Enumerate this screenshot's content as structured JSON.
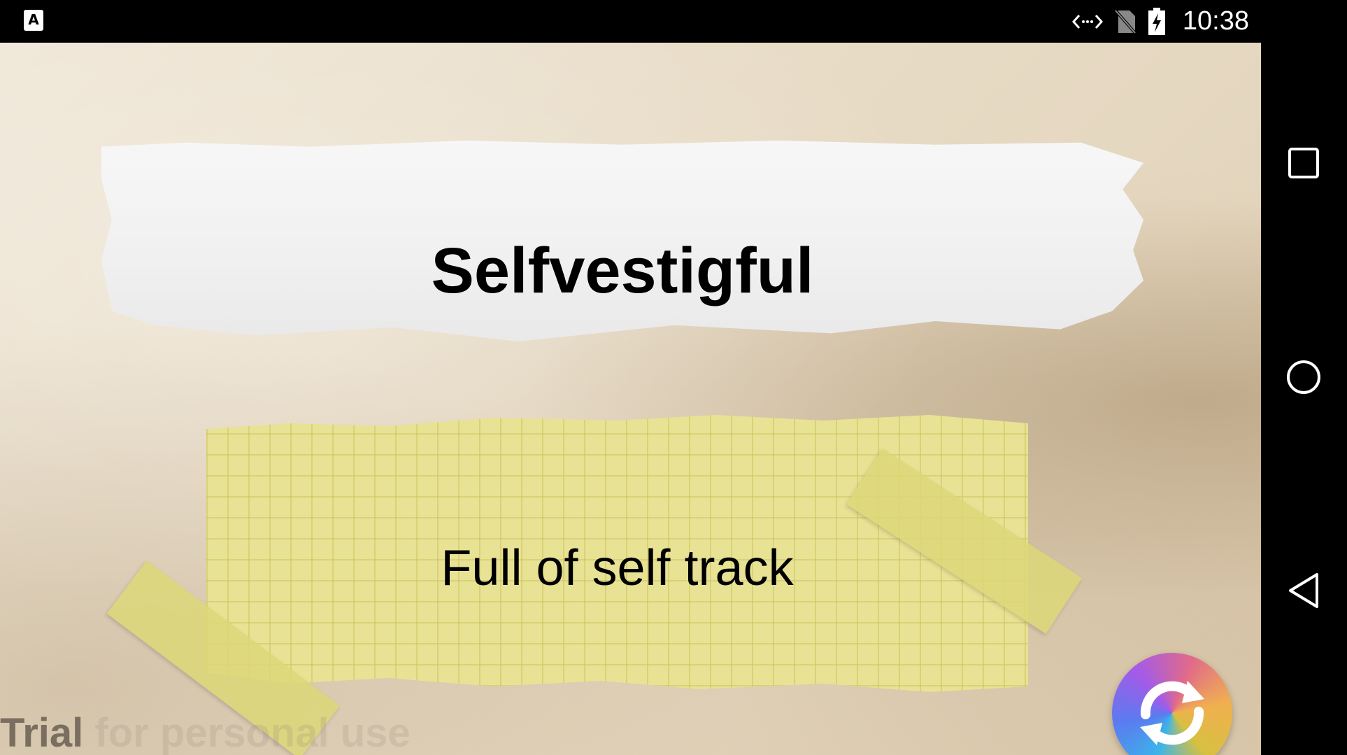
{
  "status_bar": {
    "app_icon_letter": "A",
    "time": "10:38",
    "icons": [
      "app-notification-icon",
      "data-transfer-icon",
      "no-sim-icon",
      "battery-charging-icon"
    ]
  },
  "card": {
    "word": "Selfvestigful",
    "definition": "Full of self track"
  },
  "watermark": {
    "strong_text": "Trial",
    "faint_text": " for personal use"
  },
  "actions": {
    "refresh_icon": "refresh-icon"
  },
  "nav_bar": {
    "buttons": [
      "recents-icon",
      "home-icon",
      "back-icon"
    ]
  },
  "colors": {
    "note_yellow": "#e8e295",
    "tape_yellow": "#dcd778",
    "paper_white": "#f4f4f4",
    "background_parchment": "#e8dcc7"
  }
}
